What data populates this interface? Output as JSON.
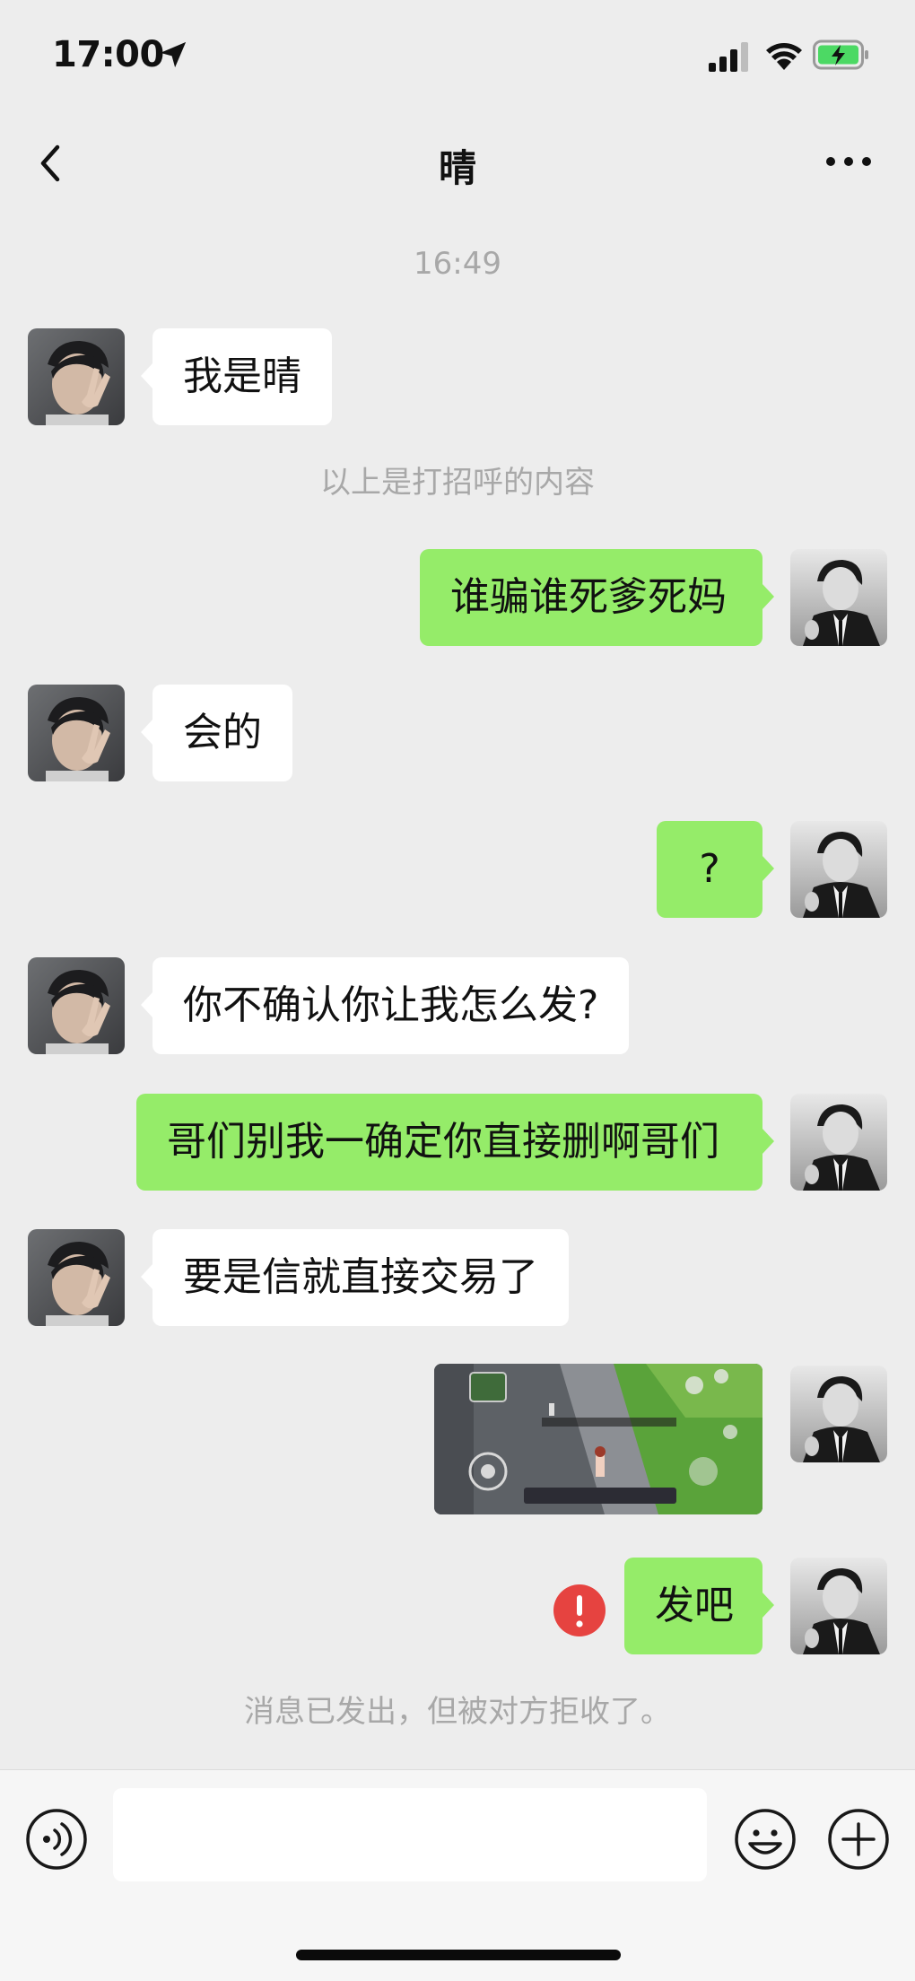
{
  "status_bar": {
    "time": "17:00",
    "location_icon": "location-arrow-icon",
    "signal_icon": "cellular-signal-icon",
    "wifi_icon": "wifi-icon",
    "battery_icon": "battery-charging-icon",
    "battery_color": "#4cd964"
  },
  "nav": {
    "back_icon": "chevron-left-icon",
    "title": "晴",
    "more_icon": "more-dots-icon"
  },
  "chat": {
    "timestamp": "16:49",
    "greeting_notice": "以上是打招呼的内容",
    "messages": [
      {
        "side": "in",
        "text": "我是晴"
      },
      {
        "side": "out",
        "text": "谁骗谁死爹死妈"
      },
      {
        "side": "in",
        "text": "会的"
      },
      {
        "side": "out",
        "text": "?"
      },
      {
        "side": "in",
        "text": "你不确认你让我怎么发?"
      },
      {
        "side": "out",
        "text": "哥们别我一确定你直接删啊哥们"
      },
      {
        "side": "in",
        "text": "要是信就直接交易了"
      },
      {
        "side": "out",
        "type": "image",
        "description": "game-screenshot-image"
      },
      {
        "side": "out",
        "text": "发吧",
        "status": "failed"
      }
    ],
    "rejected_notice": "消息已发出，但被对方拒收了。",
    "error_icon": "error-exclamation-icon",
    "error_color": "#e64340"
  },
  "input_bar": {
    "voice_icon": "voice-input-icon",
    "emoji_icon": "emoji-smile-icon",
    "plus_icon": "add-plus-icon",
    "input_value": ""
  },
  "colors": {
    "background": "#ededed",
    "outgoing_bubble": "#95ec69",
    "incoming_bubble": "#ffffff",
    "system_text": "#a8a8a8"
  }
}
